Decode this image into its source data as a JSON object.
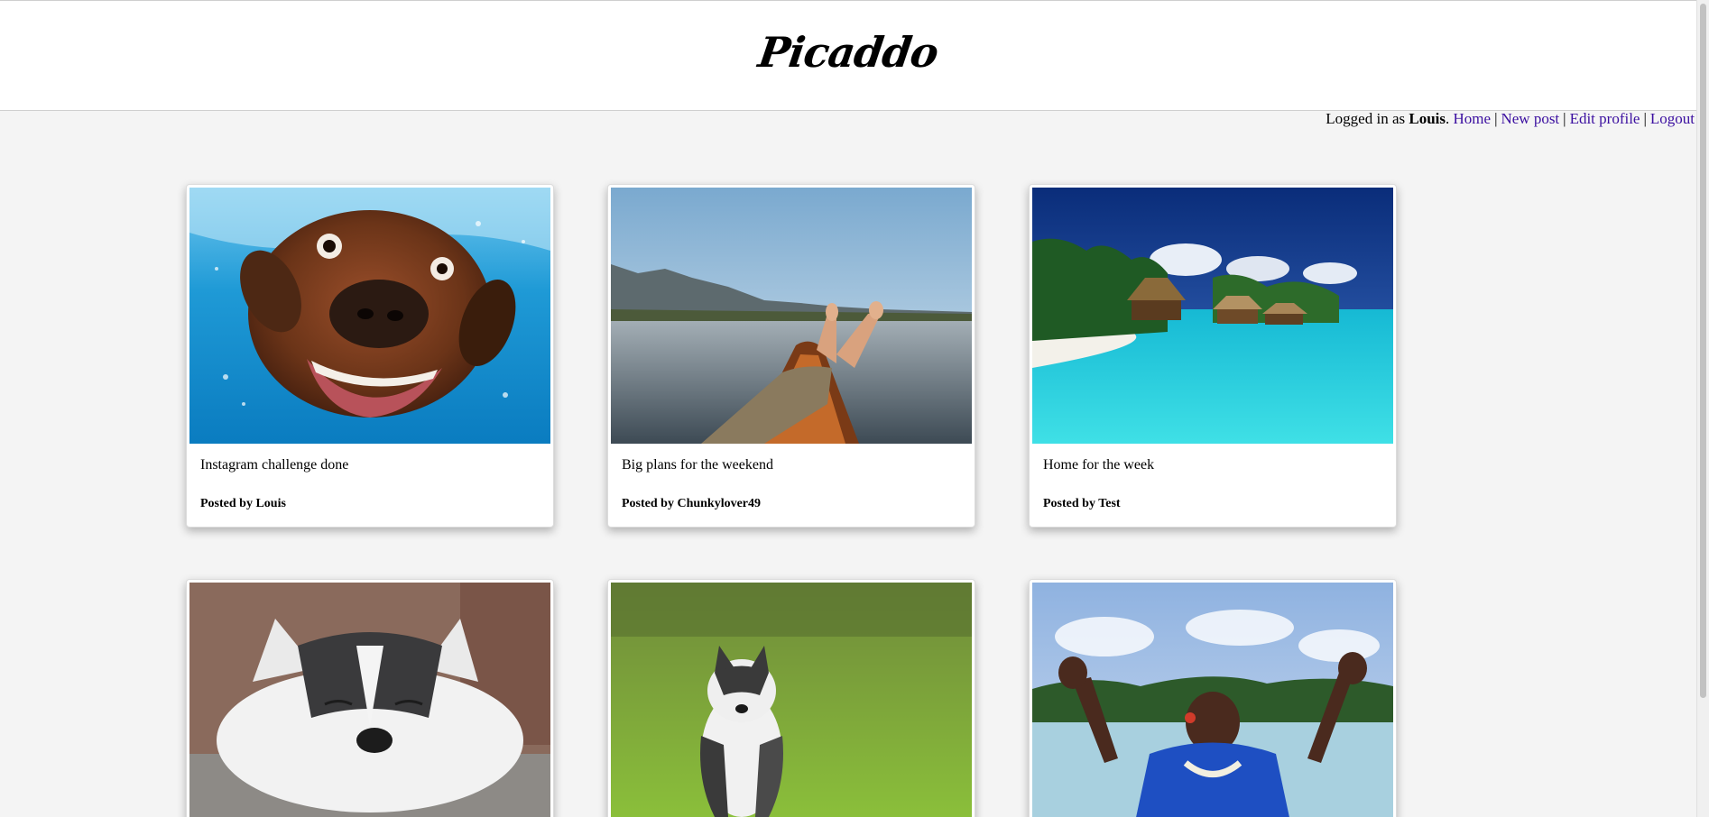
{
  "header": {
    "logo": "Picaddo"
  },
  "nav": {
    "logged_in_prefix": "Logged in as",
    "username": "Louis",
    "period": ".",
    "links": [
      {
        "label": "Home"
      },
      {
        "label": "New post"
      },
      {
        "label": "Edit profile"
      },
      {
        "label": "Logout"
      }
    ],
    "separator": "|",
    "link_color": "#3b0fa0"
  },
  "posts": [
    {
      "title": "Instagram challenge done",
      "posted_by_label": "Posted by",
      "author": "Louis",
      "image": "dog-underwater-photo"
    },
    {
      "title": "Big plans for the weekend",
      "posted_by_label": "Posted by",
      "author": "Chunkylover49",
      "image": "feet-on-boat-lake-photo"
    },
    {
      "title": "Home for the week",
      "posted_by_label": "Posted by",
      "author": "Test",
      "image": "tropical-beach-resort-photo"
    },
    {
      "title": "",
      "posted_by_label": "",
      "author": "",
      "image": "sleeping-husky-puppy-photo"
    },
    {
      "title": "",
      "posted_by_label": "",
      "author": "",
      "image": "husky-puppy-in-grass-photo"
    },
    {
      "title": "",
      "posted_by_label": "",
      "author": "",
      "image": "man-cheering-at-beach-photo"
    }
  ]
}
